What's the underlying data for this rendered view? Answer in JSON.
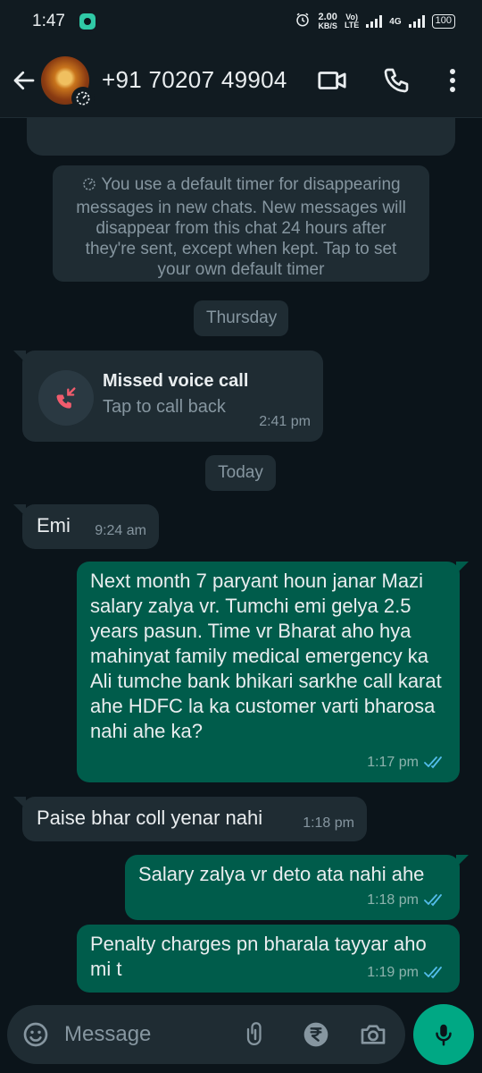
{
  "status_bar": {
    "time": "1:47",
    "speed_value": "2.00",
    "speed_unit": "KB/S",
    "volte": "Vo)",
    "lte": "LTE",
    "net_label": "4G",
    "battery": "100"
  },
  "header": {
    "contact_name": "+91 70207 49904",
    "icons": [
      "back-arrow-icon",
      "video-call-icon",
      "voice-call-icon",
      "more-options-icon"
    ]
  },
  "notice": {
    "text": "You use a default timer for disappearing messages in new chats. New messages will disappear from this chat 24 hours after they're sent, except when kept. Tap to set your own default timer"
  },
  "date_chips": {
    "thursday": "Thursday",
    "today": "Today"
  },
  "missed_call": {
    "title": "Missed voice call",
    "subtitle": "Tap to call back",
    "time": "2:41 pm"
  },
  "messages": [
    {
      "direction": "in",
      "text": "Emi",
      "time": "9:24 am"
    },
    {
      "direction": "out",
      "text": "Next month 7 paryant houn janar Mazi salary zalya vr. Tumchi emi gelya 2.5 years pasun. Time vr Bharat aho hya mahinyat family medical emergency ka Ali tumche bank bhikari sarkhe call karat ahe HDFC la ka customer varti bharosa nahi ahe ka?",
      "time": "1:17 pm"
    },
    {
      "direction": "in",
      "text": "Paise bhar coll yenar nahi",
      "time": "1:18 pm"
    },
    {
      "direction": "out",
      "text": "Salary zalya vr deto ata nahi ahe",
      "time": "1:18 pm"
    },
    {
      "direction": "out",
      "text": "Penalty charges pn bharala tayyar aho mi t",
      "time": "1:19 pm"
    }
  ],
  "composer": {
    "placeholder": "Message"
  },
  "colors": {
    "background": "#0b141a",
    "incoming_bubble": "#1f2c33",
    "outgoing_bubble": "#005c4b",
    "accent": "#00a884",
    "read_ticks": "#53bdeb",
    "missed_call_red": "#f15c6d"
  }
}
